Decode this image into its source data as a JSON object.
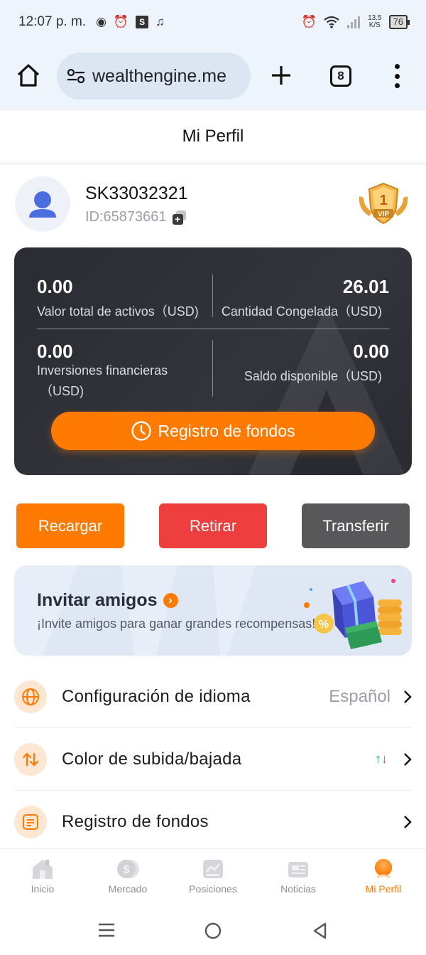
{
  "status_bar": {
    "time": "12:07 p. m.",
    "speed_value": "13.5",
    "speed_unit": "K/S",
    "battery": "76",
    "notif_s": "S"
  },
  "browser": {
    "url": "wealthengine.me",
    "tab_count": "8"
  },
  "page": {
    "title": "Mi Perfil"
  },
  "profile": {
    "username": "SK33032321",
    "user_id": "ID:65873661",
    "vip_level": "1",
    "vip_text": "VIP"
  },
  "assets": {
    "total_value": "0.00",
    "total_label": "Valor total de activos（USD)",
    "frozen_value": "26.01",
    "frozen_label": "Cantidad Congelada（USD)",
    "investments_value": "0.00",
    "investments_label_1": "Inversiones financieras",
    "investments_label_2": "（USD)",
    "available_value": "0.00",
    "available_label": "Saldo disponible（USD)",
    "fund_button": "Registro de fondos"
  },
  "actions": {
    "recharge": "Recargar",
    "withdraw": "Retirar",
    "transfer": "Transferir"
  },
  "invite": {
    "title": "Invitar amigos",
    "subtitle": "¡Invite amigos para ganar grandes recompensas!"
  },
  "menu": [
    {
      "label": "Configuración de idioma",
      "value": "Español",
      "icon": "globe-icon"
    },
    {
      "label": "Color de subida/bajada",
      "icon": "up-down-arrows-icon"
    },
    {
      "label": "Registro de fondos",
      "icon": "document-icon"
    }
  ],
  "tabs": [
    {
      "label": "Inicio",
      "icon": "home-icon"
    },
    {
      "label": "Mercado",
      "icon": "dollar-icon"
    },
    {
      "label": "Posiciones",
      "icon": "chart-icon"
    },
    {
      "label": "Noticias",
      "icon": "news-icon"
    },
    {
      "label": "Mi Perfil",
      "icon": "profile-icon",
      "active": true
    }
  ],
  "colors": {
    "accent": "#ff7a00",
    "danger": "#ef3e3e",
    "neutral_button": "#58585b",
    "card_dark": "#2b2c33"
  }
}
